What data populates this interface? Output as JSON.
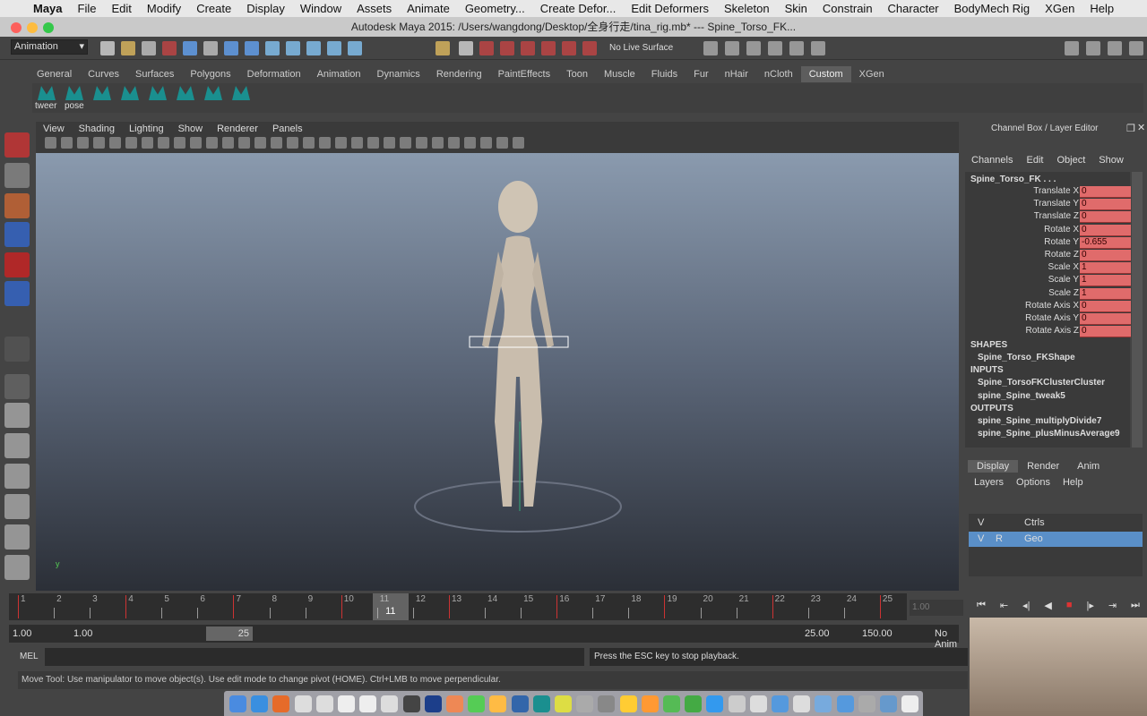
{
  "mac_menu": [
    "Maya",
    "File",
    "Edit",
    "Modify",
    "Create",
    "Display",
    "Window",
    "Assets",
    "Animate",
    "Geometry...",
    "Create Defor...",
    "Edit Deformers",
    "Skeleton",
    "Skin",
    "Constrain",
    "Character",
    "BodyMech Rig",
    "XGen",
    "Help"
  ],
  "window_title": "Autodesk Maya 2015: /Users/wangdong/Desktop/全身行走/tina_rig.mb*   ---   Spine_Torso_FK...",
  "status": {
    "menu_set": "Animation",
    "live_surface": "No Live Surface"
  },
  "shelf_tabs": [
    "General",
    "Curves",
    "Surfaces",
    "Polygons",
    "Deformation",
    "Animation",
    "Dynamics",
    "Rendering",
    "PaintEffects",
    "Toon",
    "Muscle",
    "Fluids",
    "Fur",
    "nHair",
    "nCloth",
    "Custom",
    "XGen"
  ],
  "shelf_active": "Custom",
  "shelf_labels": [
    "tweer",
    "pose"
  ],
  "viewport_menu": [
    "View",
    "Shading",
    "Lighting",
    "Show",
    "Renderer",
    "Panels"
  ],
  "channel_box": {
    "title": "Channel Box / Layer Editor",
    "menu": [
      "Channels",
      "Edit",
      "Object",
      "Show"
    ],
    "object": "Spine_Torso_FK . . .",
    "channels": [
      [
        "Translate X",
        "0"
      ],
      [
        "Translate Y",
        "0"
      ],
      [
        "Translate Z",
        "0"
      ],
      [
        "Rotate X",
        "0"
      ],
      [
        "Rotate Y",
        "-0.655"
      ],
      [
        "Rotate Z",
        "0"
      ],
      [
        "Scale X",
        "1"
      ],
      [
        "Scale Y",
        "1"
      ],
      [
        "Scale Z",
        "1"
      ],
      [
        "Rotate Axis X",
        "0"
      ],
      [
        "Rotate Axis Y",
        "0"
      ],
      [
        "Rotate Axis Z",
        "0"
      ]
    ],
    "shapes_label": "SHAPES",
    "shapes": [
      "Spine_Torso_FKShape"
    ],
    "inputs_label": "INPUTS",
    "inputs": [
      "Spine_TorsoFKClusterCluster",
      "spine_Spine_tweak5"
    ],
    "outputs_label": "OUTPUTS",
    "outputs": [
      "spine_Spine_multiplyDivide7",
      "spine_Spine_plusMinusAverage9"
    ]
  },
  "layer_editor": {
    "tabs": [
      "Display",
      "Render",
      "Anim"
    ],
    "menu": [
      "Layers",
      "Options",
      "Help"
    ],
    "layers": [
      {
        "v": "V",
        "r": "",
        "name": "Ctrls"
      },
      {
        "v": "V",
        "r": "R",
        "name": "Geo"
      }
    ]
  },
  "timeline": {
    "start": 1,
    "end": 25,
    "current": "11",
    "current_field": "1.00"
  },
  "range": {
    "start": "1.00",
    "start2": "1.00",
    "inner_start": "1",
    "inner_end": "25",
    "end": "25.00",
    "end2": "150.00",
    "anim_layer": "No Anim"
  },
  "command": {
    "label": "MEL",
    "result": "Press the ESC key to stop playback."
  },
  "help_line": "Move Tool: Use manipulator to move object(s). Use edit mode to change pivot (HOME).  Ctrl+LMB to move perpendicular.",
  "colors": {
    "keyed": "#e06b6b",
    "accent": "#5a8fc8"
  }
}
